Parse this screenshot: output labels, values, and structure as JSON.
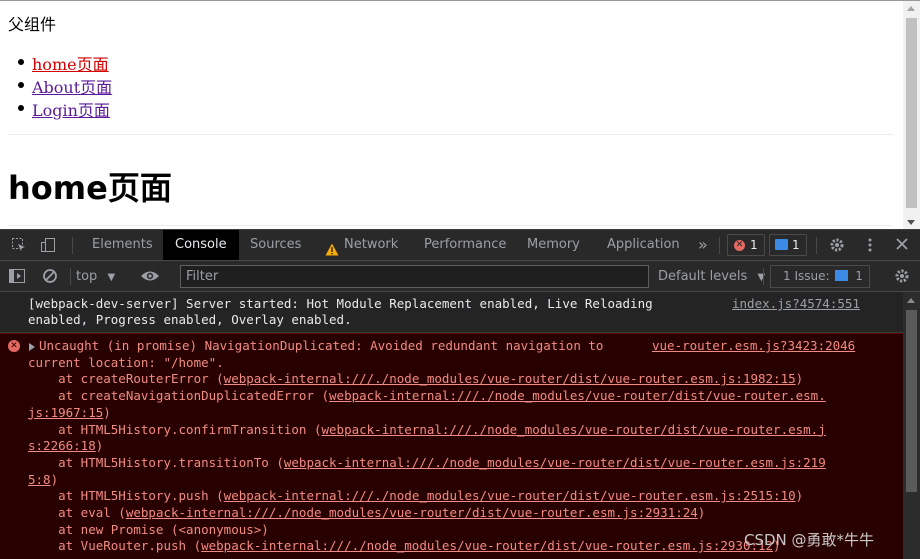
{
  "page": {
    "parent_text": "父组件",
    "nav_links": [
      "home页面",
      "About页面",
      "Login页面"
    ],
    "heading": "home页面",
    "link_colors": {
      "visited_active": "#d20000",
      "normal": "#5a1a9b"
    }
  },
  "devtools": {
    "tabs": [
      "Elements",
      "Console",
      "Sources",
      "Network",
      "Performance",
      "Memory",
      "Application"
    ],
    "active_tab": "Console",
    "more_tabs_glyph": "»",
    "error_count": "1",
    "message_count": "1",
    "toolbar": {
      "context": "top",
      "filter_placeholder": "Filter",
      "levels": "Default levels",
      "issues_label": "1 Issue:",
      "issues_count": "1"
    },
    "icons": {
      "inspect": "inspect-element-icon",
      "device": "device-toolbar-icon",
      "network_warning": "warning-icon",
      "settings": "gear-icon",
      "more": "kebab-menu-icon",
      "close": "close-icon",
      "sidebar": "sidebar-toggle-icon",
      "clear": "clear-console-icon",
      "eye": "live-expression-icon"
    },
    "console": {
      "info_message": "[webpack-dev-server] Server started: Hot Module Replacement enabled, Live Reloading\nenabled, Progress enabled, Overlay enabled.",
      "info_source": "index.js?4574:551",
      "error_source": "vue-router.esm.js?3423:2046",
      "error_lines": [
        {
          "prefix": "Uncaught (in promise) NavigationDuplicated: Avoided redundant navigation to ",
          "link": "",
          "suffix": ""
        },
        {
          "prefix": "current location: \"/home\".",
          "link": "",
          "suffix": ""
        },
        {
          "prefix": "    at createRouterError (",
          "link": "webpack-internal:///./node_modules/vue-router/dist/vue-router.esm.js:1982:15",
          "suffix": ")"
        },
        {
          "prefix": "    at createNavigationDuplicatedError (",
          "link": "webpack-internal:///./node_modules/vue-router/dist/vue-router.esm.",
          "suffix": ""
        },
        {
          "prefix": "",
          "link": "js:1967:15",
          "suffix": ")"
        },
        {
          "prefix": "    at HTML5History.confirmTransition (",
          "link": "webpack-internal:///./node_modules/vue-router/dist/vue-router.esm.j",
          "suffix": ""
        },
        {
          "prefix": "",
          "link": "s:2266:18",
          "suffix": ")"
        },
        {
          "prefix": "    at HTML5History.transitionTo (",
          "link": "webpack-internal:///./node_modules/vue-router/dist/vue-router.esm.js:219",
          "suffix": ""
        },
        {
          "prefix": "",
          "link": "5:8",
          "suffix": ")"
        },
        {
          "prefix": "    at HTML5History.push (",
          "link": "webpack-internal:///./node_modules/vue-router/dist/vue-router.esm.js:2515:10",
          "suffix": ")"
        },
        {
          "prefix": "    at eval (",
          "link": "webpack-internal:///./node_modules/vue-router/dist/vue-router.esm.js:2931:24",
          "suffix": ")"
        },
        {
          "prefix": "    at new Promise (<anonymous>)",
          "link": "",
          "suffix": ""
        },
        {
          "prefix": "    at VueRouter.push (",
          "link": "webpack-internal:///./node_modules/vue-router/dist/vue-router.esm.js:2930:12",
          "suffix": ")"
        }
      ]
    }
  },
  "watermark": "CSDN @勇敢*牛牛"
}
